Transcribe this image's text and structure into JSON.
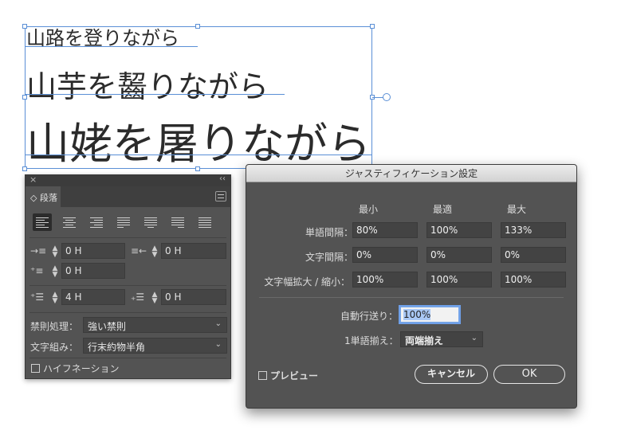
{
  "canvas": {
    "lines": [
      "山路を登りながら",
      "山芋を齧りながら",
      "山姥を屠りながら"
    ]
  },
  "paragraph_panel": {
    "close_glyph": "×",
    "collapse_glyph": "‹‹",
    "tab_label": "◇ 段落",
    "left_indent": "0 H",
    "right_indent": "0 H",
    "first_line_indent": "0 H",
    "space_before": "4 H",
    "space_after": "0 H",
    "kinsoku_label": "禁則処理：",
    "kinsoku_value": "強い禁則",
    "mojikumi_label": "文字組み：",
    "mojikumi_value": "行末約物半角",
    "hyphenation_label": "ハイフネーション"
  },
  "dialog": {
    "title": "ジャスティフィケーション設定",
    "col_min": "最小",
    "col_opt": "最適",
    "col_max": "最大",
    "rows": [
      {
        "label": "単語間隔：",
        "min": "80%",
        "opt": "100%",
        "max": "133%"
      },
      {
        "label": "文字間隔：",
        "min": "0%",
        "opt": "0%",
        "max": "0%"
      },
      {
        "label": "文字幅拡大 / 縮小：",
        "min": "100%",
        "opt": "100%",
        "max": "100%"
      }
    ],
    "auto_leading_label": "自動行送り：",
    "auto_leading_value": "100%",
    "single_word_label": "1単語揃え：",
    "single_word_value": "両端揃え",
    "preview_label": "プレビュー",
    "cancel_label": "キャンセル",
    "ok_label": "OK"
  },
  "colors": {
    "selection": "#5a8fd6",
    "panel": "#535353",
    "focus": "#6fa0e8"
  }
}
